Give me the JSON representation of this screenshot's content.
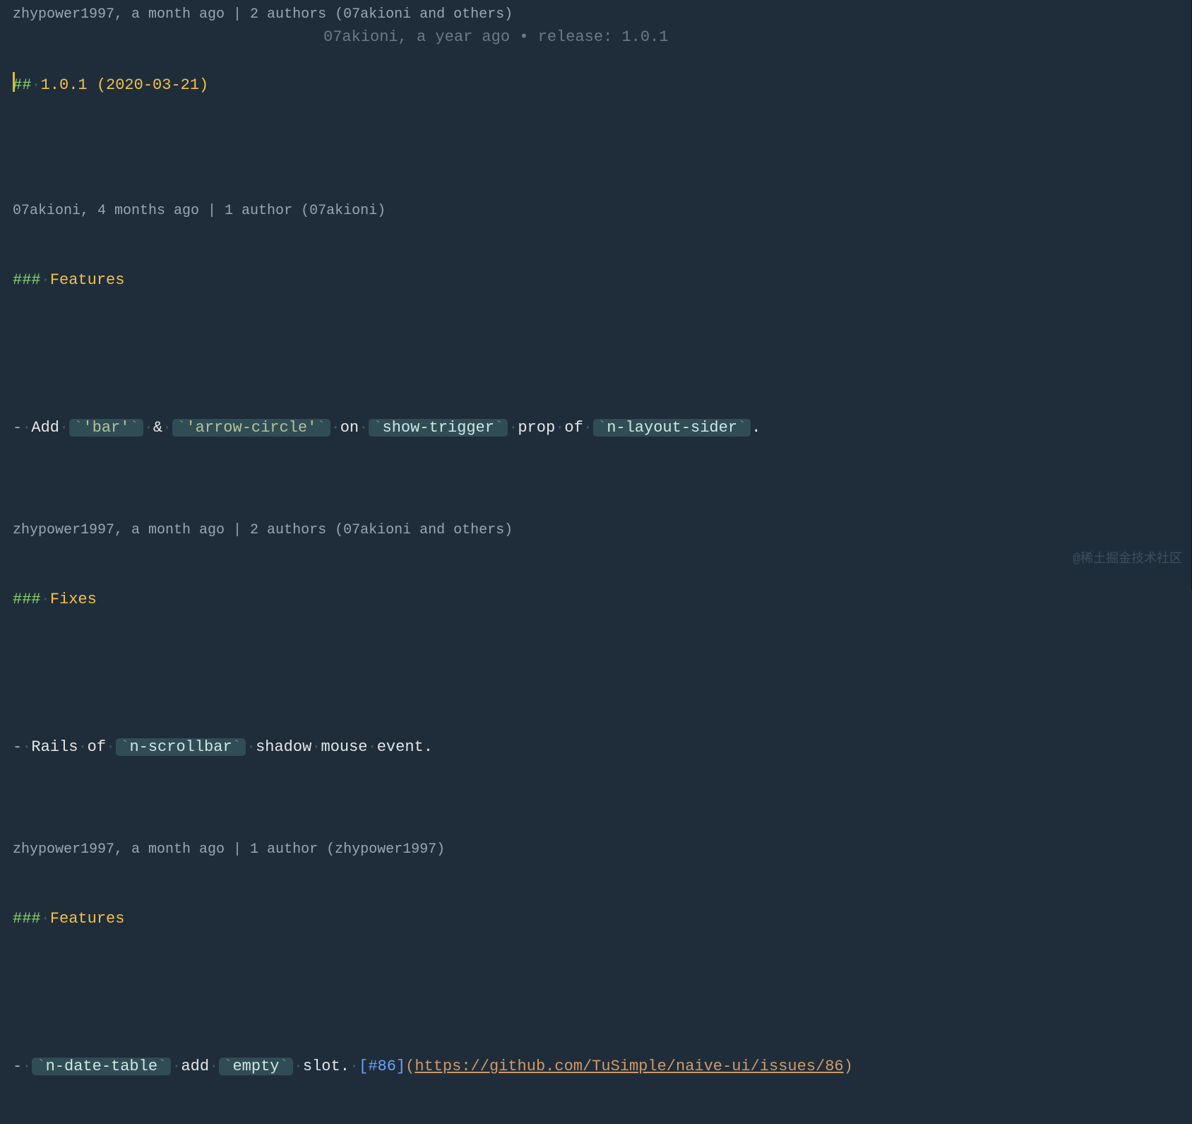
{
  "blame": {
    "a": "zhypower1997, a month ago | 2 authors (07akioni and others)",
    "b": "07akioni, 4 months ago | 1 author (07akioni)",
    "c": "zhypower1997, a month ago | 2 authors (07akioni and others)",
    "d": "zhypower1997, a month ago | 1 author (zhypower1997)"
  },
  "lens": {
    "inline": "07akioni, a year ago • release: 1.0.1"
  },
  "lines": {
    "h2": {
      "mark": "##",
      "ws": "·",
      "text": "1.0.1 (2020-03-21)"
    },
    "features1": {
      "mark": "###",
      "ws": "·",
      "text": "Features"
    },
    "bullet1": {
      "dash": "-",
      "w": "·",
      "add": "Add",
      "bar": {
        "t1": "`",
        "s": "'bar'",
        "t2": "`"
      },
      "amp": "&",
      "arrow": {
        "t1": "`",
        "s": "'arrow-circle'",
        "t2": "`"
      },
      "on": "on",
      "show_trigger": {
        "t1": "`",
        "s": "show-trigger",
        "t2": "`"
      },
      "prop": "prop",
      "of": "of",
      "layout": {
        "t1": "`",
        "s": "n-layout-sider",
        "t2": "`"
      },
      "dot": "."
    },
    "fixes": {
      "mark": "###",
      "ws": "·",
      "text": "Fixes"
    },
    "bullet2": {
      "dash": "-",
      "w": "·",
      "rails": "Rails",
      "of": "of",
      "scroll": {
        "t1": "`",
        "s": "n-scrollbar",
        "t2": "`"
      },
      "rest": "shadow",
      "mouse": "mouse",
      "event": "event."
    },
    "features2": {
      "mark": "###",
      "ws": "·",
      "text": "Features"
    },
    "bullet3": {
      "dash": "-",
      "w": "·",
      "date": {
        "t1": "`",
        "s": "n-date-table",
        "t2": "`"
      },
      "add": "add",
      "empty": {
        "t1": "`",
        "s": "empty",
        "t2": "`"
      },
      "slot": "slot.",
      "ref_open": "[",
      "ref": "#86",
      "ref_close": "]",
      "p_open": "(",
      "url": "https://github.com/TuSimple/naive-ui/issues/86",
      "p_close": ")"
    }
  },
  "watermark": "@稀土掘金技术社区"
}
